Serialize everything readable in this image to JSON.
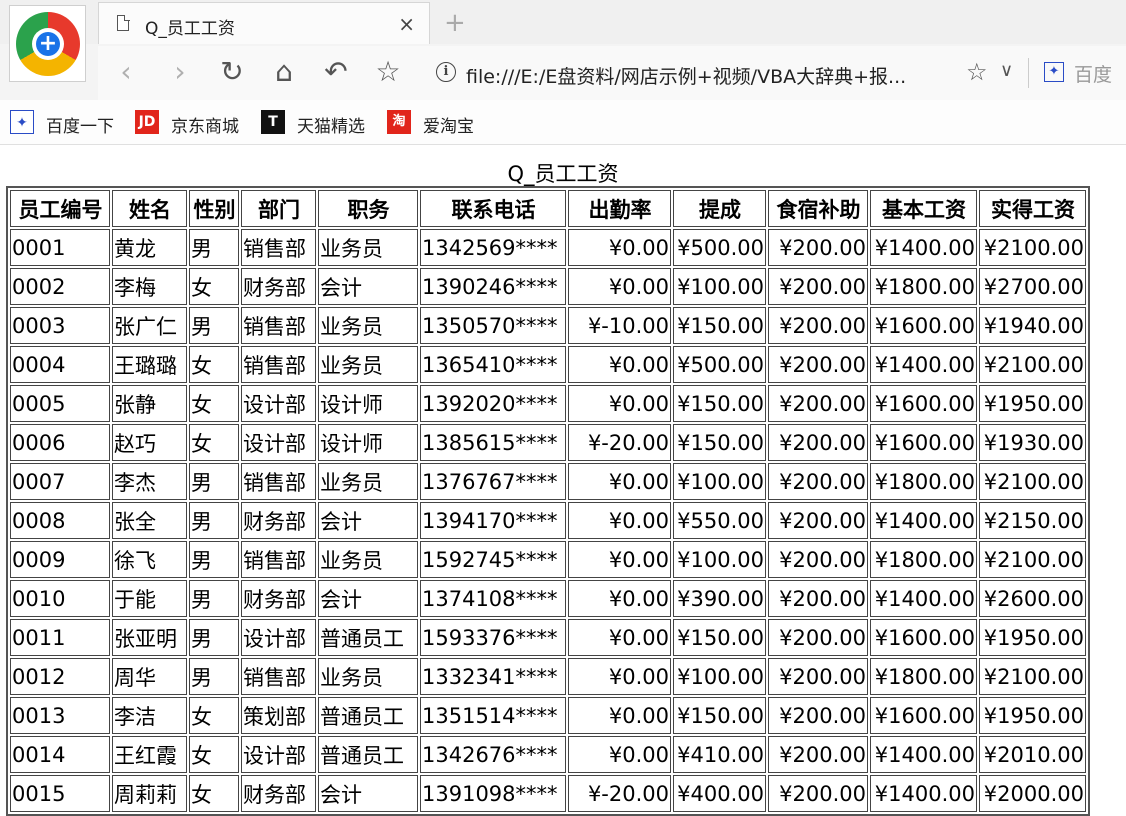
{
  "browser": {
    "tab_title": "Q_员工工资",
    "tab_close": "×",
    "new_tab": "+",
    "url": "file:///E:/E盘资料/网店示例+视频/VBA大辞典+报...",
    "search_engine": "百度",
    "bookmarks": [
      {
        "label": "百度一下",
        "icon": "baidu-paw-icon",
        "color": "#2a4cc6"
      },
      {
        "label": "京东商城",
        "icon": "jd-icon",
        "color": "#e1251b"
      },
      {
        "label": "天猫精选",
        "icon": "tmall-icon",
        "color": "#e1251b"
      },
      {
        "label": "爱淘宝",
        "icon": "taobao-icon",
        "color": "#e1251b"
      }
    ]
  },
  "report": {
    "title": "Q_员工工资",
    "columns": [
      "员工编号",
      "姓名",
      "性别",
      "部门",
      "职务",
      "联系电话",
      "出勤率",
      "提成",
      "食宿补助",
      "基本工资",
      "实得工资"
    ],
    "rows": [
      [
        "0001",
        "黄龙",
        "男",
        "销售部",
        "业务员",
        "1342569****",
        "¥0.00",
        "¥500.00",
        "¥200.00",
        "¥1400.00",
        "¥2100.00"
      ],
      [
        "0002",
        "李梅",
        "女",
        "财务部",
        "会计",
        "1390246****",
        "¥0.00",
        "¥100.00",
        "¥200.00",
        "¥1800.00",
        "¥2700.00"
      ],
      [
        "0003",
        "张广仁",
        "男",
        "销售部",
        "业务员",
        "1350570****",
        "¥-10.00",
        "¥150.00",
        "¥200.00",
        "¥1600.00",
        "¥1940.00"
      ],
      [
        "0004",
        "王璐璐",
        "女",
        "销售部",
        "业务员",
        "1365410****",
        "¥0.00",
        "¥500.00",
        "¥200.00",
        "¥1400.00",
        "¥2100.00"
      ],
      [
        "0005",
        "张静",
        "女",
        "设计部",
        "设计师",
        "1392020****",
        "¥0.00",
        "¥150.00",
        "¥200.00",
        "¥1600.00",
        "¥1950.00"
      ],
      [
        "0006",
        "赵巧",
        "女",
        "设计部",
        "设计师",
        "1385615****",
        "¥-20.00",
        "¥150.00",
        "¥200.00",
        "¥1600.00",
        "¥1930.00"
      ],
      [
        "0007",
        "李杰",
        "男",
        "销售部",
        "业务员",
        "1376767****",
        "¥0.00",
        "¥100.00",
        "¥200.00",
        "¥1800.00",
        "¥2100.00"
      ],
      [
        "0008",
        "张全",
        "男",
        "财务部",
        "会计",
        "1394170****",
        "¥0.00",
        "¥550.00",
        "¥200.00",
        "¥1400.00",
        "¥2150.00"
      ],
      [
        "0009",
        "徐飞",
        "男",
        "销售部",
        "业务员",
        "1592745****",
        "¥0.00",
        "¥100.00",
        "¥200.00",
        "¥1800.00",
        "¥2100.00"
      ],
      [
        "0010",
        "于能",
        "男",
        "财务部",
        "会计",
        "1374108****",
        "¥0.00",
        "¥390.00",
        "¥200.00",
        "¥1400.00",
        "¥2600.00"
      ],
      [
        "0011",
        "张亚明",
        "男",
        "设计部",
        "普通员工",
        "1593376****",
        "¥0.00",
        "¥150.00",
        "¥200.00",
        "¥1600.00",
        "¥1950.00"
      ],
      [
        "0012",
        "周华",
        "男",
        "销售部",
        "业务员",
        "1332341****",
        "¥0.00",
        "¥100.00",
        "¥200.00",
        "¥1800.00",
        "¥2100.00"
      ],
      [
        "0013",
        "李洁",
        "女",
        "策划部",
        "普通员工",
        "1351514****",
        "¥0.00",
        "¥150.00",
        "¥200.00",
        "¥1600.00",
        "¥1950.00"
      ],
      [
        "0014",
        "王红霞",
        "女",
        "设计部",
        "普通员工",
        "1342676****",
        "¥0.00",
        "¥410.00",
        "¥200.00",
        "¥1400.00",
        "¥2010.00"
      ],
      [
        "0015",
        "周莉莉",
        "女",
        "财务部",
        "会计",
        "1391098****",
        "¥-20.00",
        "¥400.00",
        "¥200.00",
        "¥1400.00",
        "¥2000.00"
      ]
    ]
  }
}
